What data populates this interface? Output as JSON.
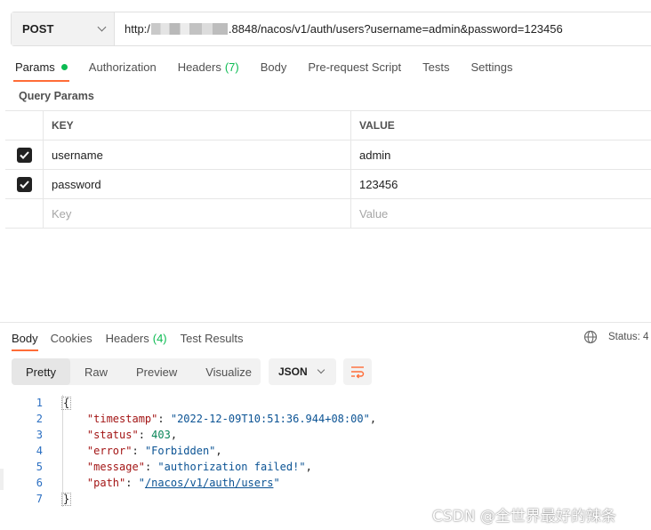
{
  "request": {
    "method": "POST",
    "url_prefix": "http:/",
    "url_suffix": ".8848/nacos/v1/auth/users?username=admin&password=123456"
  },
  "request_tabs": [
    {
      "label": "Params",
      "badge": "",
      "active": true,
      "dot": true
    },
    {
      "label": "Authorization",
      "badge": ""
    },
    {
      "label": "Headers",
      "badge": "(7)"
    },
    {
      "label": "Body",
      "badge": ""
    },
    {
      "label": "Pre-request Script",
      "badge": ""
    },
    {
      "label": "Tests",
      "badge": ""
    },
    {
      "label": "Settings",
      "badge": ""
    }
  ],
  "query_params": {
    "title": "Query Params",
    "header_key": "KEY",
    "header_value": "VALUE",
    "rows": [
      {
        "key": "username",
        "value": "admin",
        "checked": true
      },
      {
        "key": "password",
        "value": "123456",
        "checked": true
      }
    ],
    "placeholder_key": "Key",
    "placeholder_value": "Value"
  },
  "response_tabs": [
    {
      "label": "Body",
      "badge": "",
      "active": true
    },
    {
      "label": "Cookies",
      "badge": ""
    },
    {
      "label": "Headers",
      "badge": "(4)"
    },
    {
      "label": "Test Results",
      "badge": ""
    }
  ],
  "status_label": "Status: 4",
  "view_options": [
    "Pretty",
    "Raw",
    "Preview",
    "Visualize"
  ],
  "format": "JSON",
  "code_lines": [
    "1",
    "2",
    "3",
    "4",
    "5",
    "6",
    "7"
  ],
  "json": {
    "timestamp_key": "\"timestamp\"",
    "timestamp_val": "\"2022-12-09T10:51:36.944+08:00\"",
    "status_key": "\"status\"",
    "status_val": "403",
    "error_key": "\"error\"",
    "error_val": "\"Forbidden\"",
    "message_key": "\"message\"",
    "message_val": "\"authorization failed!\"",
    "path_key": "\"path\"",
    "path_val": "/nacos/v1/auth/users"
  },
  "watermark": "CSDN @全世界最好的辣条",
  "colors": {
    "accent": "#ff6c37",
    "success": "#0cbb52",
    "checkbox": "#212121"
  }
}
